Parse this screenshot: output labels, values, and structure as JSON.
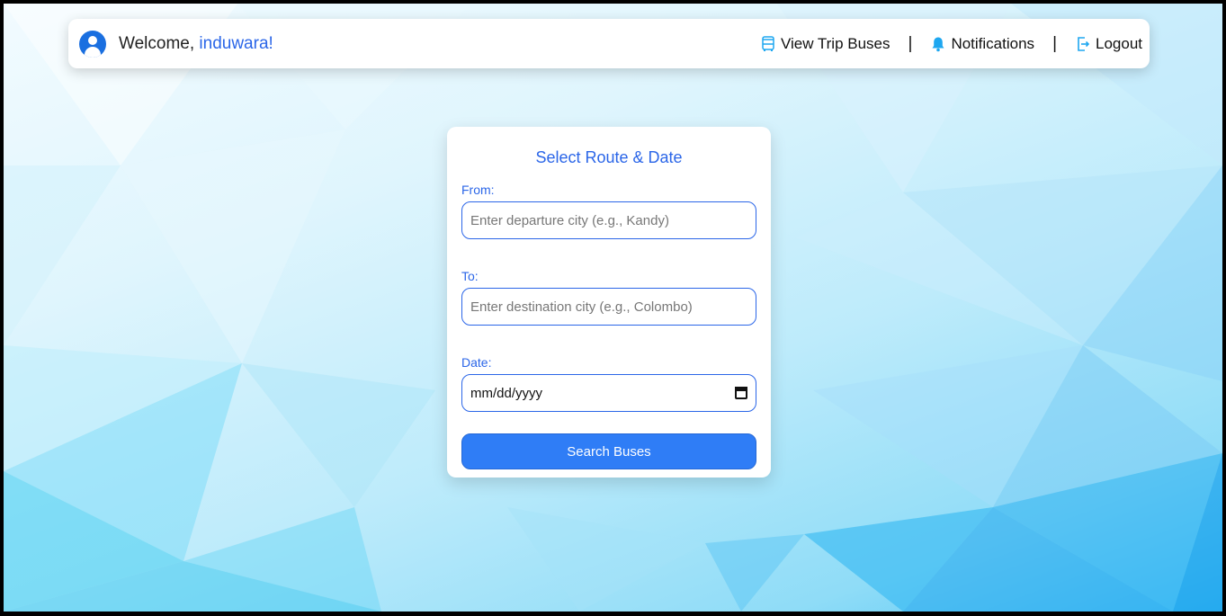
{
  "header": {
    "welcome_prefix": "Welcome,",
    "username": "induwara!",
    "nav": {
      "trip_buses": "View Trip Buses",
      "notifications": "Notifications",
      "logout": "Logout",
      "separator": "|"
    }
  },
  "form": {
    "title": "Select Route & Date",
    "from_label": "From:",
    "from_placeholder": "Enter departure city (e.g., Kandy)",
    "to_label": "To:",
    "to_placeholder": "Enter destination city (e.g., Colombo)",
    "date_label": "Date:",
    "date_value": "mm/dd/yyyy",
    "submit_label": "Search Buses"
  },
  "colors": {
    "accent": "#2b66e8",
    "button": "#2f7df6",
    "avatar": "#1a6fe0",
    "bell": "#1ea7f0"
  },
  "icons": {
    "avatar": "user-circle-icon",
    "trip_buses": "bus-icon",
    "notifications": "bell-icon",
    "logout": "logout-icon",
    "date": "calendar-icon"
  }
}
